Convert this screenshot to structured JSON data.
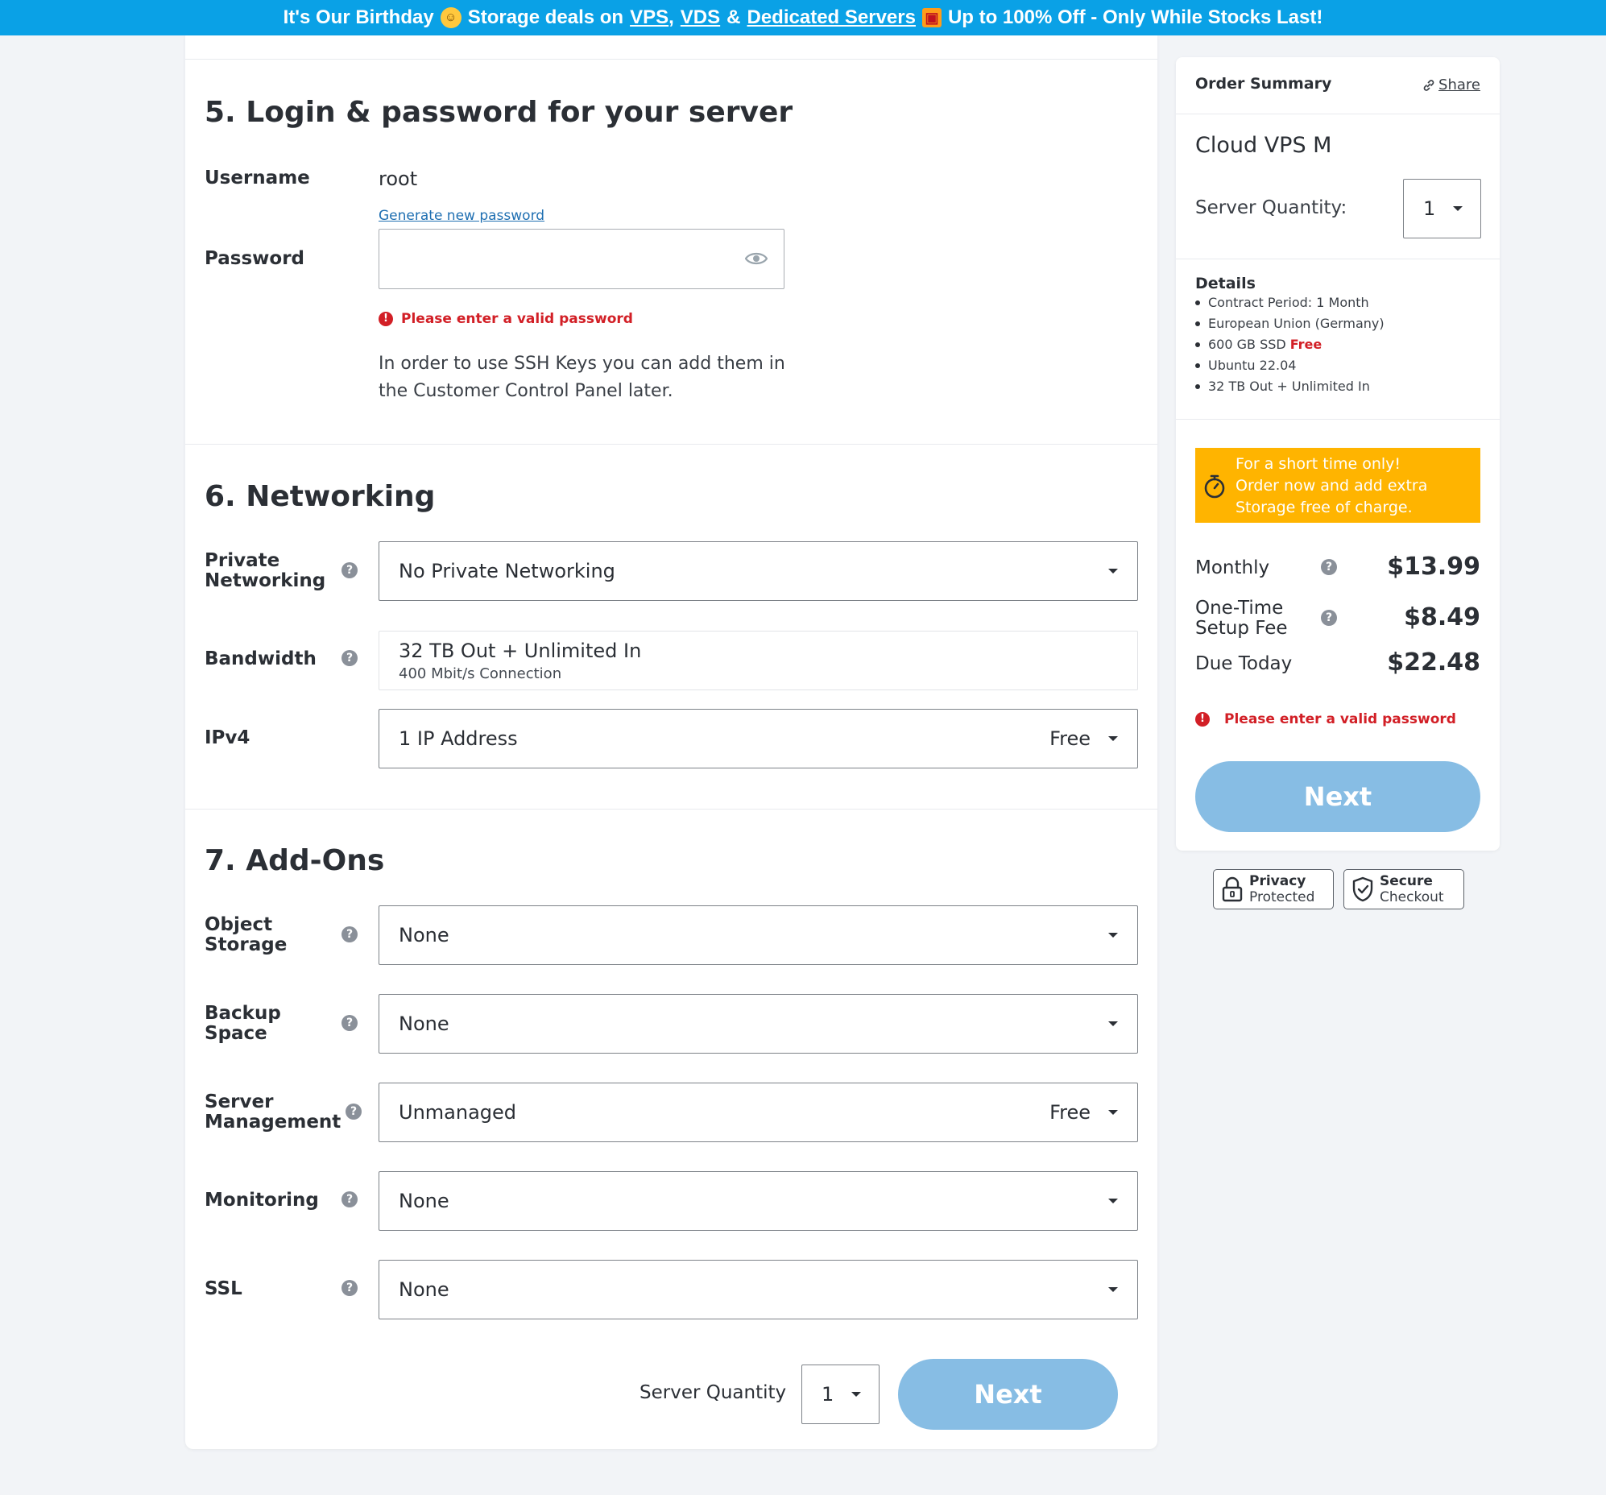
{
  "banner": {
    "part1": "It's Our Birthday",
    "part2": "Storage deals on",
    "link_vps": "VPS",
    "comma": ",",
    "link_vds": "VDS",
    "amp": "&",
    "link_dedicated": "Dedicated Servers",
    "part3": "Up to 100% Off - Only While Stocks Last!",
    "background_color": "#0aa1e6"
  },
  "login_section": {
    "title": "5. Login & password for your server",
    "username_label": "Username",
    "username_value": "root",
    "generate_link": "Generate new password",
    "password_label": "Password",
    "password_value": "",
    "error": "Please enter a valid password",
    "ssh_note": "In order to use SSH Keys you can add them in the Customer Control Panel later."
  },
  "networking_section": {
    "title": "6. Networking",
    "private_networking_label_1": "Private",
    "private_networking_label_2": "Networking",
    "private_networking_value": "No Private Networking",
    "bandwidth_label": "Bandwidth",
    "bandwidth_value": "32 TB Out + Unlimited In",
    "bandwidth_sub": "400 Mbit/s Connection",
    "ipv4_label": "IPv4",
    "ipv4_value": "1 IP Address",
    "ipv4_tag": "Free"
  },
  "addons_section": {
    "title": "7. Add-Ons",
    "object_storage_label_1": "Object",
    "object_storage_label_2": "Storage",
    "object_storage_value": "None",
    "backup_label_1": "Backup",
    "backup_label_2": "Space",
    "backup_value": "None",
    "management_label_1": "Server",
    "management_label_2": "Management",
    "management_value": "Unmanaged",
    "management_tag": "Free",
    "monitoring_label": "Monitoring",
    "monitoring_value": "None",
    "ssl_label": "SSL",
    "ssl_value": "None"
  },
  "footer": {
    "quantity_label": "Server Quantity",
    "quantity_value": "1",
    "next_label": "Next"
  },
  "summary": {
    "title": "Order Summary",
    "share_label": "Share",
    "product": "Cloud VPS M",
    "quantity_label": "Server Quantity:",
    "quantity_value": "1",
    "details_title": "Details",
    "details": [
      {
        "text": "Contract Period: 1 Month",
        "tag": ""
      },
      {
        "text": "European Union (Germany)",
        "tag": ""
      },
      {
        "text": "600 GB SSD",
        "tag": "Free"
      },
      {
        "text": "Ubuntu 22.04",
        "tag": ""
      },
      {
        "text": "32 TB Out + Unlimited In",
        "tag": ""
      }
    ],
    "promo_text_1": "For a short time only!",
    "promo_text_2": "Order now and add extra",
    "promo_text_3": "Storage free of charge.",
    "promo_color": "#ffb400",
    "monthly_label": "Monthly",
    "monthly_value": "$13.99",
    "setup_label_1": "One-Time",
    "setup_label_2": "Setup Fee",
    "setup_value": "$8.49",
    "due_label": "Due Today",
    "due_value": "$22.48",
    "error": "Please enter a valid password",
    "next_label": "Next",
    "next_color": "#87bde4"
  },
  "badges": {
    "privacy_title": "Privacy",
    "privacy_sub": "Protected",
    "secure_title": "Secure",
    "secure_sub": "Checkout"
  },
  "icons": {
    "help": "question-circle-icon",
    "error": "exclamation-circle-icon",
    "eye": "eye-icon",
    "caret": "chevron-down-icon",
    "share": "link-icon",
    "timer": "stopwatch-icon",
    "lock": "lock-icon",
    "shield": "shield-check-icon"
  }
}
